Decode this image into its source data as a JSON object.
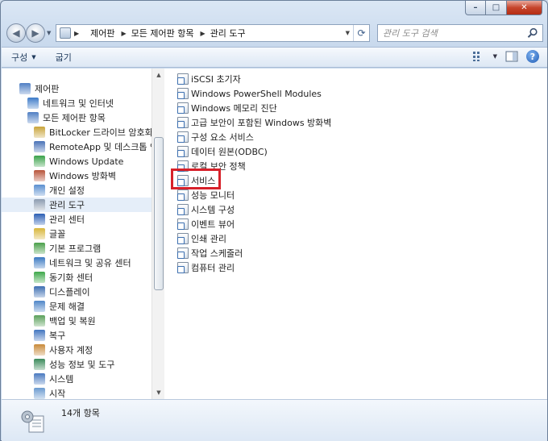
{
  "window": {
    "controls": {
      "minimize": "–",
      "maximize": "□",
      "close": "✕"
    }
  },
  "address": {
    "breadcrumbs": [
      "제어판",
      "모든 제어판 항목",
      "관리 도구"
    ]
  },
  "search": {
    "placeholder": "관리 도구 검색"
  },
  "toolbar": {
    "organize": "구성",
    "burn": "굽기"
  },
  "nav_tree": [
    {
      "label": "제어판",
      "level": 0,
      "icon": "control-panel-icon"
    },
    {
      "label": "네트워크 및 인터넷",
      "level": 1,
      "icon": "network-icon"
    },
    {
      "label": "모든 제어판 항목",
      "level": 1,
      "icon": "control-panel-icon"
    },
    {
      "label": "BitLocker 드라이브 암호화",
      "level": 2,
      "icon": "bitlocker-icon"
    },
    {
      "label": "RemoteApp 및 데스크톱 연",
      "level": 2,
      "icon": "remoteapp-icon"
    },
    {
      "label": "Windows Update",
      "level": 2,
      "icon": "windows-update-icon"
    },
    {
      "label": "Windows 방화벽",
      "level": 2,
      "icon": "firewall-icon"
    },
    {
      "label": "개인 설정",
      "level": 2,
      "icon": "personalization-icon"
    },
    {
      "label": "관리 도구",
      "level": 2,
      "icon": "admin-tools-icon",
      "selected": true
    },
    {
      "label": "관리 센터",
      "level": 2,
      "icon": "action-center-icon"
    },
    {
      "label": "글꼴",
      "level": 2,
      "icon": "fonts-icon"
    },
    {
      "label": "기본 프로그램",
      "level": 2,
      "icon": "default-programs-icon"
    },
    {
      "label": "네트워크 및 공유 센터",
      "level": 2,
      "icon": "network-sharing-icon"
    },
    {
      "label": "동기화 센터",
      "level": 2,
      "icon": "sync-center-icon"
    },
    {
      "label": "디스플레이",
      "level": 2,
      "icon": "display-icon"
    },
    {
      "label": "문제 해결",
      "level": 2,
      "icon": "troubleshoot-icon"
    },
    {
      "label": "백업 및 복원",
      "level": 2,
      "icon": "backup-icon"
    },
    {
      "label": "복구",
      "level": 2,
      "icon": "recovery-icon"
    },
    {
      "label": "사용자 계정",
      "level": 2,
      "icon": "user-accounts-icon"
    },
    {
      "label": "성능 정보 및 도구",
      "level": 2,
      "icon": "performance-icon"
    },
    {
      "label": "시스템",
      "level": 2,
      "icon": "system-icon"
    },
    {
      "label": "시작",
      "level": 2,
      "icon": "getting-started-icon"
    }
  ],
  "files": [
    "iSCSI 초기자",
    "Windows PowerShell Modules",
    "Windows 메모리 진단",
    "고급 보안이 포함된 Windows 방화벽",
    "구성 요소 서비스",
    "데이터 원본(ODBC)",
    "로컬 보안 정책",
    "서비스",
    "성능 모니터",
    "시스템 구성",
    "이벤트 뷰어",
    "인쇄 관리",
    "작업 스케줄러",
    "컴퓨터 관리"
  ],
  "highlighted_file": "서비스",
  "status": {
    "count_text": "14개 항목"
  },
  "icon_colors": {
    "control-panel-icon": "#4f7fc4",
    "network-icon": "#3d7bc9",
    "bitlocker-icon": "#c9a43a",
    "remoteapp-icon": "#4a73b8",
    "windows-update-icon": "#3aa24a",
    "firewall-icon": "#b8543a",
    "personalization-icon": "#5a8fd0",
    "admin-tools-icon": "#8c9bb0",
    "action-center-icon": "#2c5fb5",
    "fonts-icon": "#d8b63a",
    "default-programs-icon": "#4aa04a",
    "network-sharing-icon": "#3a79c2",
    "sync-center-icon": "#3ea84a",
    "display-icon": "#3d6fb3",
    "troubleshoot-icon": "#4f86c8",
    "backup-icon": "#5aa05a",
    "recovery-icon": "#4276c0",
    "user-accounts-icon": "#c98a3a",
    "performance-icon": "#3a8a5a",
    "system-icon": "#4a7ac0",
    "getting-started-icon": "#6a9ad0"
  }
}
